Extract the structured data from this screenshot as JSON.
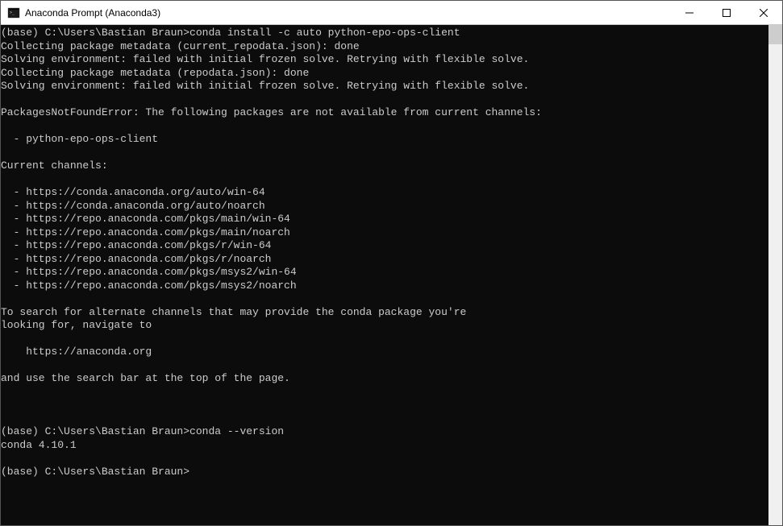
{
  "window": {
    "title": "Anaconda Prompt (Anaconda3)"
  },
  "terminal": {
    "lines": [
      "(base) C:\\Users\\Bastian Braun>conda install -c auto python-epo-ops-client",
      "Collecting package metadata (current_repodata.json): done",
      "Solving environment: failed with initial frozen solve. Retrying with flexible solve.",
      "Collecting package metadata (repodata.json): done",
      "Solving environment: failed with initial frozen solve. Retrying with flexible solve.",
      "",
      "PackagesNotFoundError: The following packages are not available from current channels:",
      "",
      "  - python-epo-ops-client",
      "",
      "Current channels:",
      "",
      "  - https://conda.anaconda.org/auto/win-64",
      "  - https://conda.anaconda.org/auto/noarch",
      "  - https://repo.anaconda.com/pkgs/main/win-64",
      "  - https://repo.anaconda.com/pkgs/main/noarch",
      "  - https://repo.anaconda.com/pkgs/r/win-64",
      "  - https://repo.anaconda.com/pkgs/r/noarch",
      "  - https://repo.anaconda.com/pkgs/msys2/win-64",
      "  - https://repo.anaconda.com/pkgs/msys2/noarch",
      "",
      "To search for alternate channels that may provide the conda package you're",
      "looking for, navigate to",
      "",
      "    https://anaconda.org",
      "",
      "and use the search bar at the top of the page.",
      "",
      "",
      "",
      "(base) C:\\Users\\Bastian Braun>conda --version",
      "conda 4.10.1",
      "",
      "(base) C:\\Users\\Bastian Braun>"
    ]
  }
}
